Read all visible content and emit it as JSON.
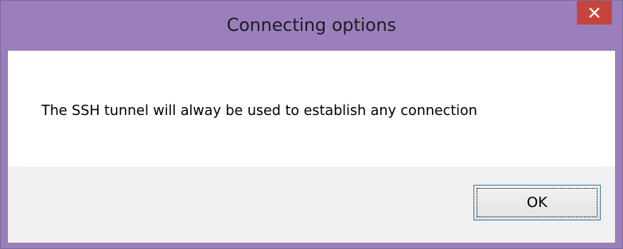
{
  "window": {
    "title": "Connecting options",
    "title_bar_color": "#9b7fbd",
    "close_button_color": "#c7443c",
    "close_icon": "close-icon"
  },
  "dialog": {
    "message": "The SSH tunnel will alway be used to establish any connection",
    "ok_label": "OK",
    "focused_button": "OK"
  }
}
